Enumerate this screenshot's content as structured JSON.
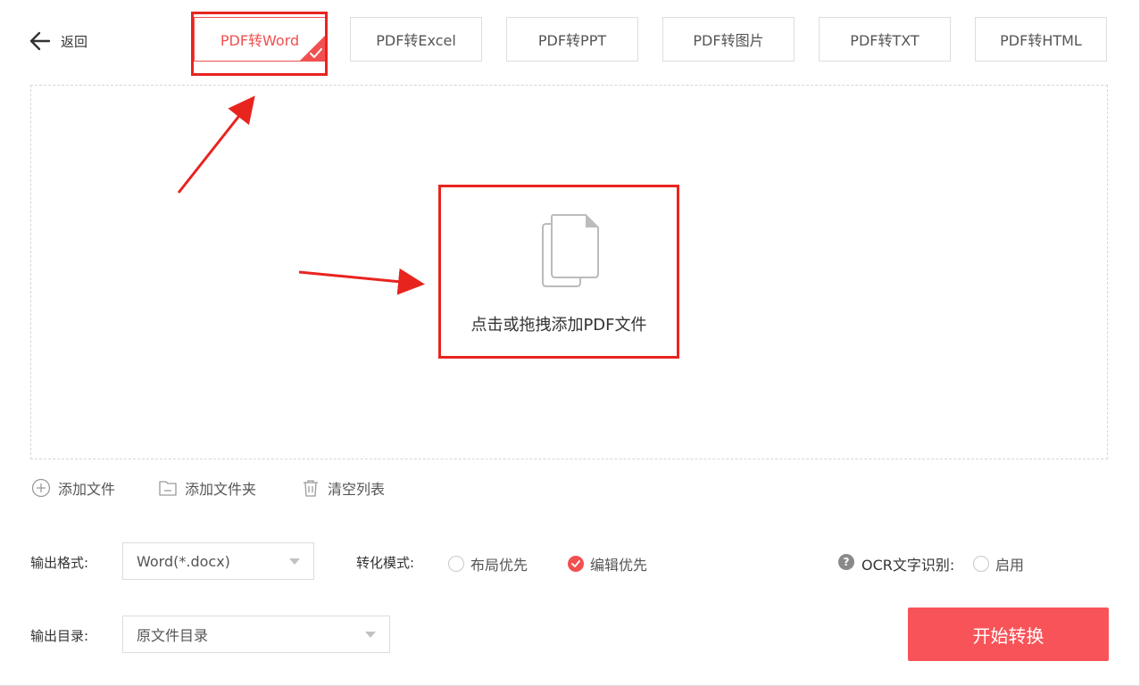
{
  "header": {
    "back_label": "返回"
  },
  "tabs": [
    {
      "label": "PDF转Word",
      "active": true
    },
    {
      "label": "PDF转Excel",
      "active": false
    },
    {
      "label": "PDF转PPT",
      "active": false
    },
    {
      "label": "PDF转图片",
      "active": false
    },
    {
      "label": "PDF转TXT",
      "active": false
    },
    {
      "label": "PDF转HTML",
      "active": false
    }
  ],
  "dropzone": {
    "text": "点击或拖拽添加PDF文件",
    "icon": "document-icon"
  },
  "actions": {
    "add_file": "添加文件",
    "add_folder": "添加文件夹",
    "clear_list": "清空列表"
  },
  "settings": {
    "format_label": "输出格式:",
    "format_value": "Word(*.docx)",
    "mode_label": "转化模式:",
    "mode_options": [
      {
        "label": "布局优先",
        "checked": false
      },
      {
        "label": "编辑优先",
        "checked": true
      }
    ],
    "ocr_label": "OCR文字识别:",
    "ocr_option": {
      "label": "启用",
      "checked": false
    },
    "dir_label": "输出目录:",
    "dir_value": "原文件目录"
  },
  "start_button": "开始转换",
  "colors": {
    "accent": "#f25050",
    "annotation": "#e8241f",
    "button": "#f85358"
  }
}
